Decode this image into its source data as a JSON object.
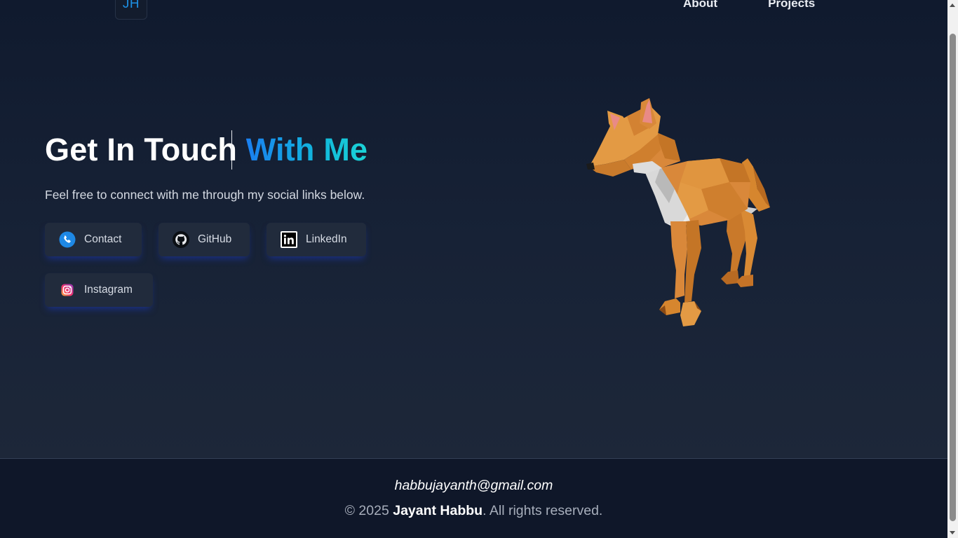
{
  "header": {
    "logo_text": "JH",
    "nav": [
      "About",
      "Projects"
    ]
  },
  "hero": {
    "title_plain": "Get In Touch ",
    "title_accent": "With Me",
    "subtitle": "Feel free to connect with me through my social links below.",
    "accent_gradient": [
      "#1a7ff0",
      "#1bd3d6"
    ],
    "social_links": [
      {
        "label": "Contact",
        "icon": "phone-icon"
      },
      {
        "label": "GitHub",
        "icon": "github-icon"
      },
      {
        "label": "LinkedIn",
        "icon": "linkedin-icon"
      },
      {
        "label": "Instagram",
        "icon": "instagram-icon"
      }
    ],
    "illustration": "low-poly-fox-3d-model"
  },
  "footer": {
    "email": "habbujayanth@gmail.com",
    "copyright_prefix": "© 2025 ",
    "copyright_name": "Jayant Habbu",
    "copyright_suffix": ". All rights reserved."
  },
  "colors": {
    "background": "#101a2e",
    "button_bg": "#212b3c",
    "button_glow": "#1e3cc8",
    "logo": "#1d8fe3"
  }
}
